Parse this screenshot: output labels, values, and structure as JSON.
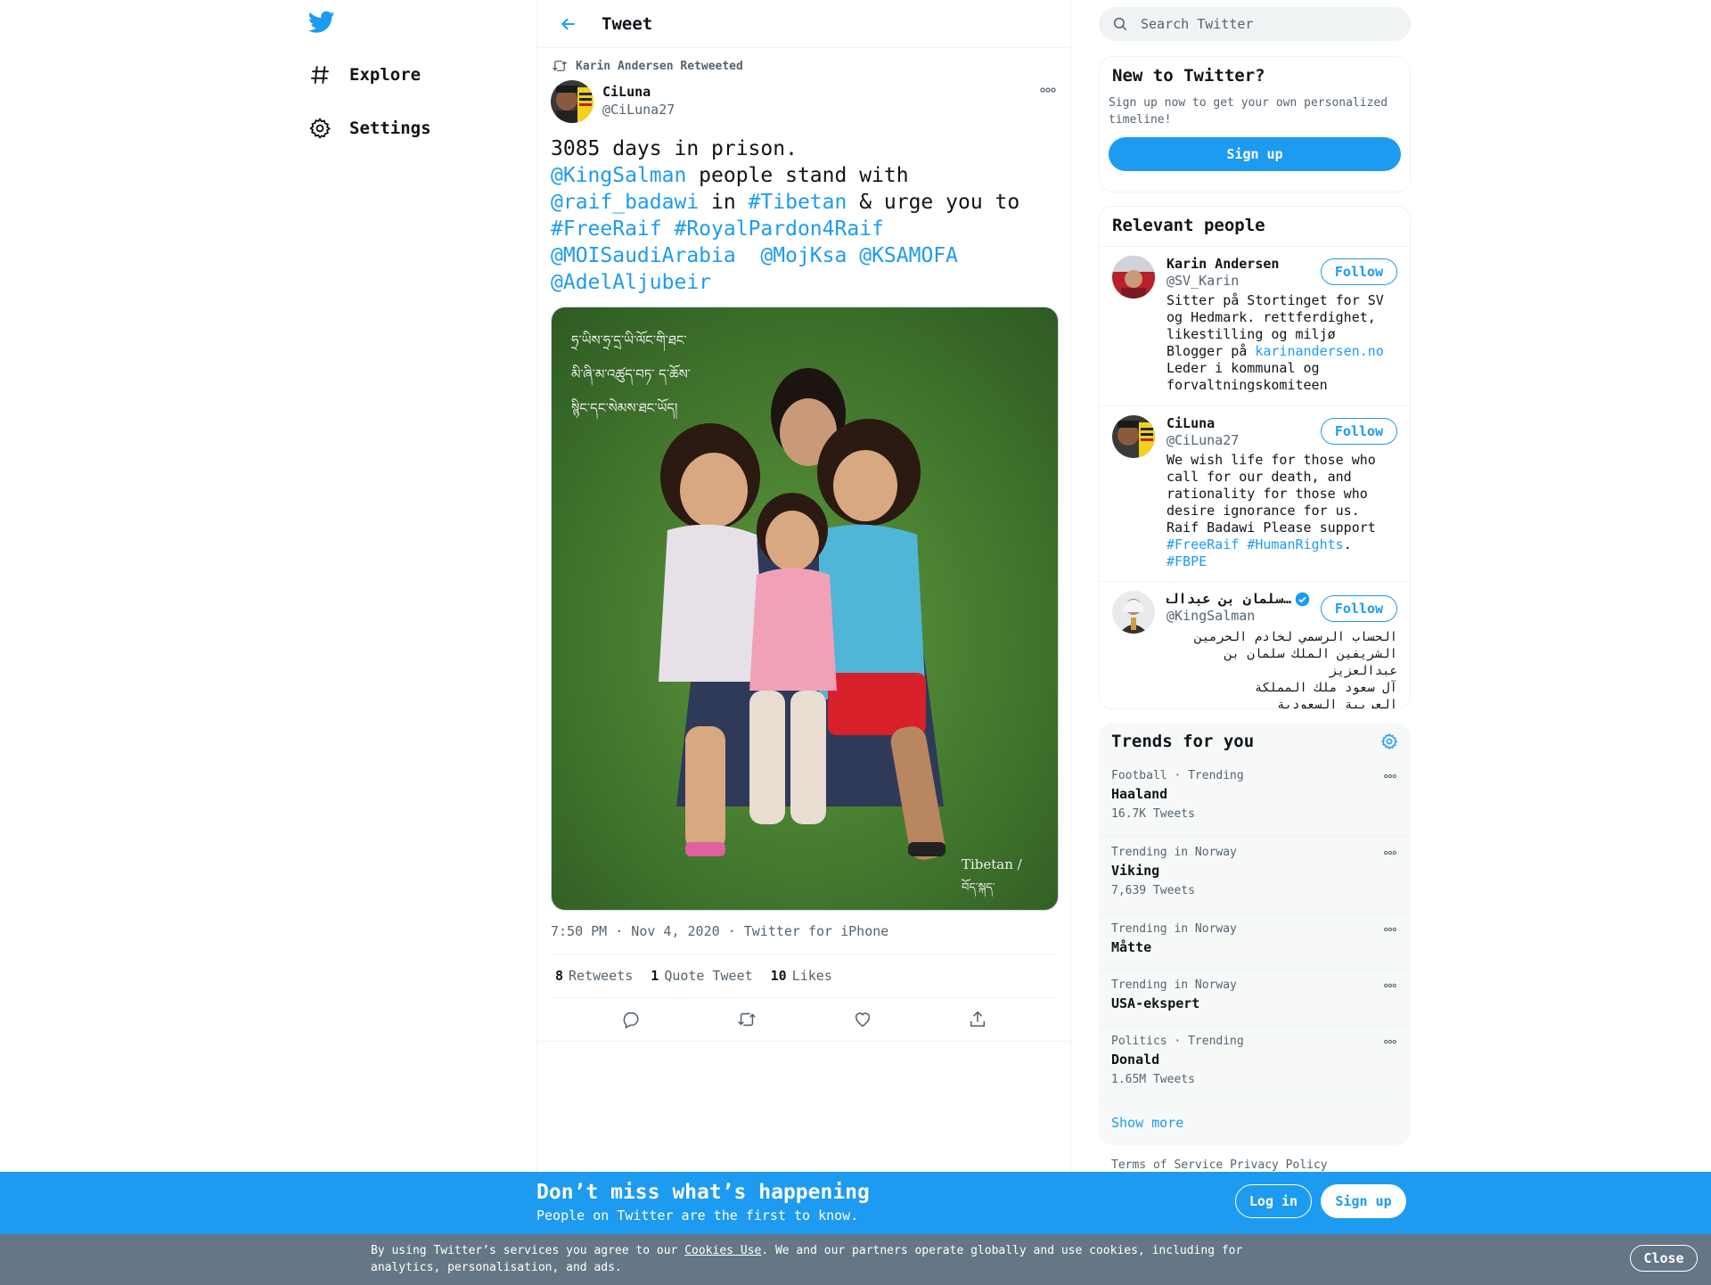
{
  "nav": {
    "items": [
      {
        "label": "Explore",
        "icon": "hashtag-icon"
      },
      {
        "label": "Settings",
        "icon": "gear-icon"
      }
    ]
  },
  "header": {
    "title": "Tweet"
  },
  "tweet": {
    "retweeted_by": "Karin Andersen Retweeted",
    "author_name": "CiLuna",
    "author_handle": "@CiLuna27",
    "text_parts": [
      {
        "t": "3085 days in prison.\n",
        "link": false
      },
      {
        "t": "@KingSalman",
        "link": true
      },
      {
        "t": " people stand with\n",
        "link": false
      },
      {
        "t": "@raif_badawi",
        "link": true
      },
      {
        "t": " in ",
        "link": false
      },
      {
        "t": "#Tibetan",
        "link": true
      },
      {
        "t": " & urge you to\n",
        "link": false
      },
      {
        "t": "#FreeRaif",
        "link": true
      },
      {
        "t": " ",
        "link": false
      },
      {
        "t": "#RoyalPardon4Raif",
        "link": true
      },
      {
        "t": "\n",
        "link": false
      },
      {
        "t": "@MOISaudiArabia",
        "link": true
      },
      {
        "t": "  ",
        "link": false
      },
      {
        "t": "@MojKsa",
        "link": true
      },
      {
        "t": " ",
        "link": false
      },
      {
        "t": "@KSAMOFA",
        "link": true
      },
      {
        "t": "\n",
        "link": false
      },
      {
        "t": "@AdelAljubeir",
        "link": true
      }
    ],
    "image_caption_tibetan": [
      "ཧྲ་ཡིས་ཧྲ་དྲ་ཡི་ལོང་གི་ཐང་",
      "མི་ཞི་མ་འཚུད་བཏ་ ད་ཆོས་",
      "སྙིང་དང་སེམས་ཐང་ཡོད།"
    ],
    "image_watermark": [
      "Tibetan /",
      "བོད་སྐད་"
    ],
    "timestamp": "7:50 PM · Nov 4, 2020",
    "source": "Twitter for iPhone",
    "stats": [
      {
        "value": "8",
        "label": "Retweets"
      },
      {
        "value": "1",
        "label": "Quote Tweet"
      },
      {
        "value": "10",
        "label": "Likes"
      }
    ]
  },
  "search": {
    "placeholder": "Search Twitter"
  },
  "new_to_twitter": {
    "title": "New to Twitter?",
    "desc": "Sign up now to get your own personalized timeline!",
    "button": "Sign up"
  },
  "relevant_people": {
    "title": "Relevant people",
    "people": [
      {
        "name": "Karin Andersen",
        "handle": "@SV_Karin",
        "bio_parts": [
          {
            "t": "Sitter på Stortinget for SV og Hedmark. rettferdighet, likestilling og miljø\nBlogger på ",
            "link": false
          },
          {
            "t": "karinandersen.no",
            "link": true
          },
          {
            "t": "\nLeder i kommunal og forvaltningskomiteen",
            "link": false
          }
        ],
        "follow": "Follow"
      },
      {
        "name": "CiLuna",
        "handle": "@CiLuna27",
        "bio_parts": [
          {
            "t": "We wish life for those who call for our death, and rationality for those who desire ignorance for us. Raif Badawi Please support ",
            "link": false
          },
          {
            "t": "#FreeRaif",
            "link": true
          },
          {
            "t": " ",
            "link": false
          },
          {
            "t": "#HumanRights",
            "link": true
          },
          {
            "t": ". ",
            "link": false
          },
          {
            "t": "#FBPE",
            "link": true
          }
        ],
        "follow": "Follow"
      },
      {
        "name": "…سلمان بن عبدالعزيز",
        "handle": "@KingSalman",
        "verified": true,
        "bio_rtl": [
          "الحساب الرسمي لخادم الحرمين",
          "الشريفين الملك سلمان بن عبدالعزيز",
          "آل سعود ملك المملكة",
          "العربية السعودية"
        ],
        "follow": "Follow"
      }
    ]
  },
  "trends": {
    "title": "Trends for you",
    "items": [
      {
        "context": "Football · Trending",
        "name": "Haaland",
        "count": "16.7K Tweets"
      },
      {
        "context": "Trending in Norway",
        "name": "Viking",
        "count": "7,639 Tweets"
      },
      {
        "context": "Trending in Norway",
        "name": "Måtte",
        "count": ""
      },
      {
        "context": "Trending in Norway",
        "name": "USA-ekspert",
        "count": ""
      },
      {
        "context": "Politics · Trending",
        "name": "Donald",
        "count": "1.65M Tweets"
      }
    ],
    "show_more": "Show more"
  },
  "footer": {
    "links": [
      "Terms of Service",
      "Privacy Policy"
    ]
  },
  "signup_bar": {
    "title": "Don’t miss what’s happening",
    "subtitle": "People on Twitter are the first to know.",
    "login": "Log in",
    "signup": "Sign up"
  },
  "cookie_bar": {
    "text_before": "By using Twitter’s services you agree to our ",
    "link": "Cookies Use",
    "text_after": ". We and our partners operate globally and use cookies, including for analytics, personalisation, and ads.",
    "close": "Close"
  },
  "colors": {
    "accent": "#1d9bf0",
    "cookie_bg": "#657786"
  }
}
